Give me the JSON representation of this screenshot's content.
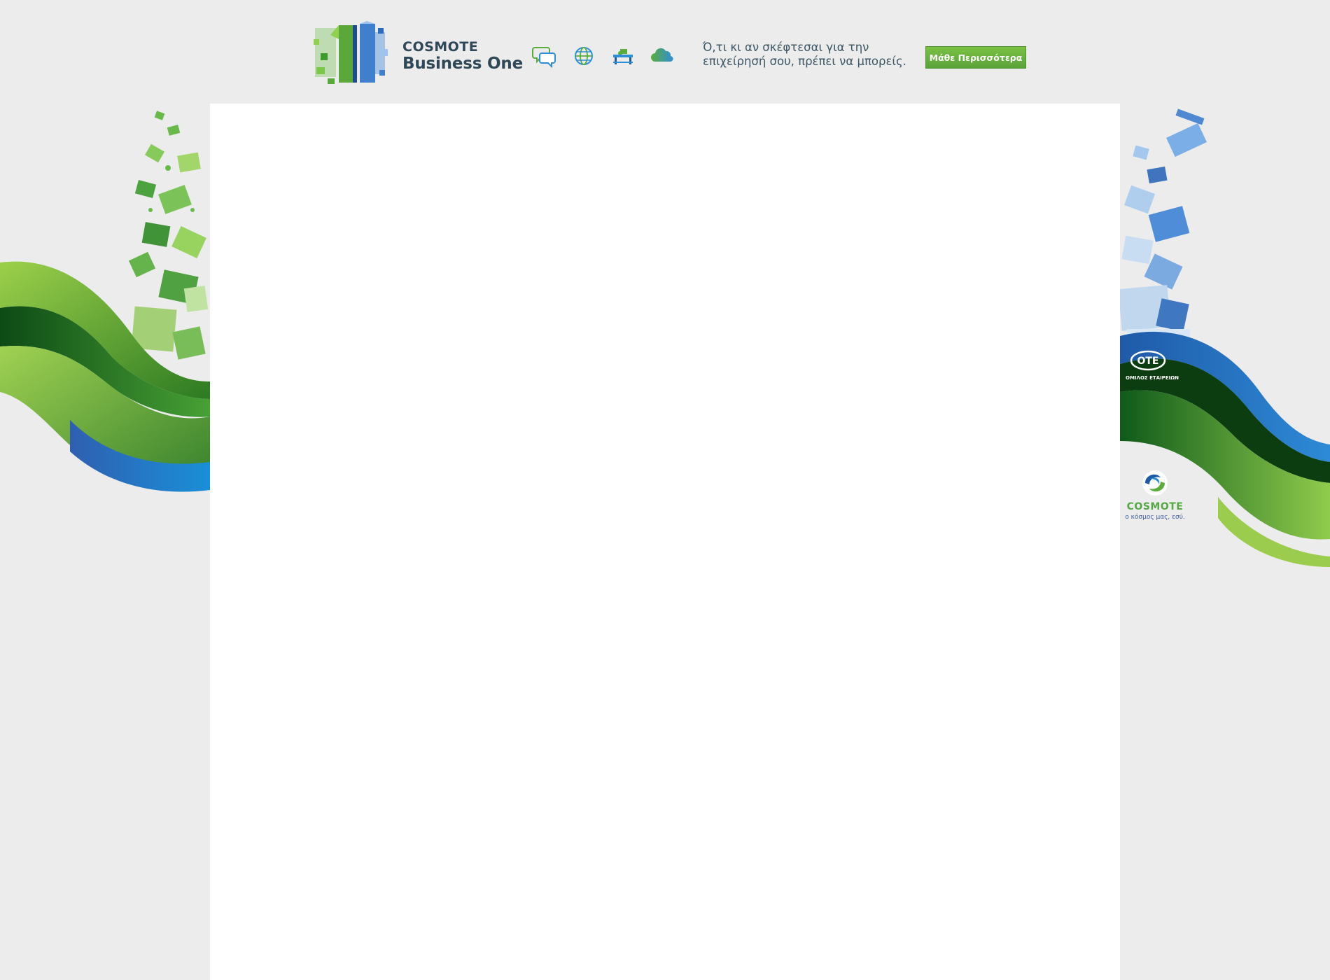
{
  "banner": {
    "brand_line1": "COSMOTE",
    "brand_line2": "Business One",
    "icons": [
      "chat-icon",
      "globe-icon",
      "desk-icon",
      "cloud-icon"
    ],
    "tagline_line1": "Ό,τι κι αν σκέφτεσαι για την",
    "tagline_line2": "επιχείρησή σου, πρέπει να μπορείς.",
    "cta_label": "Μάθε Περισσότερα"
  },
  "side": {
    "ote_label": "ΟΤΕ",
    "ote_sub": "ΟΜΙΛΟΣ ΕΤΑΙΡΕΙΩΝ",
    "cosmote_label": "COSMOTE",
    "cosmote_slogan": "ο κόσμος μας, εσύ."
  },
  "colors": {
    "background": "#ececec",
    "panel": "#ffffff",
    "brand_text": "#2f4857",
    "cta_green": "#6ab63f",
    "wave_green": "#5aa33a",
    "wave_blue": "#1f5fae"
  }
}
